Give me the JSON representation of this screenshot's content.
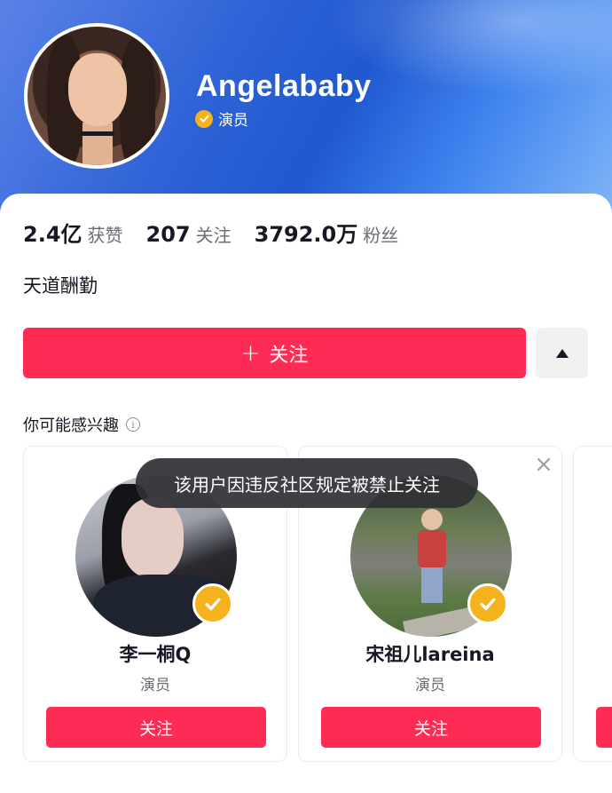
{
  "profile": {
    "name": "Angelababy",
    "verified_role": "演员",
    "stats": [
      {
        "value": "2.4亿",
        "label": "获赞"
      },
      {
        "value": "207",
        "label": "关注"
      },
      {
        "value": "3792.0万",
        "label": "粉丝"
      }
    ],
    "bio": "天道酬勤"
  },
  "actions": {
    "follow_plus": "+",
    "follow_label": "关注"
  },
  "suggestions": {
    "title": "你可能感兴趣",
    "info_glyph": "i",
    "cards": [
      {
        "name": "李一桐Q",
        "role": "演员",
        "follow_label": "关注"
      },
      {
        "name": "宋祖儿lareina",
        "role": "演员",
        "follow_label": "关注"
      },
      {
        "name": "",
        "role": "",
        "follow_label": ""
      }
    ]
  },
  "toast": {
    "text": "该用户因违反社区规定被禁止关注"
  },
  "colors": {
    "accent": "#fe2c55",
    "verified_badge": "#f5b21d",
    "header_blue": "#2f63d6"
  },
  "icons": {
    "verified": "verified-check-icon",
    "more": "triangle-up-icon",
    "info": "info-icon",
    "close": "close-icon"
  }
}
